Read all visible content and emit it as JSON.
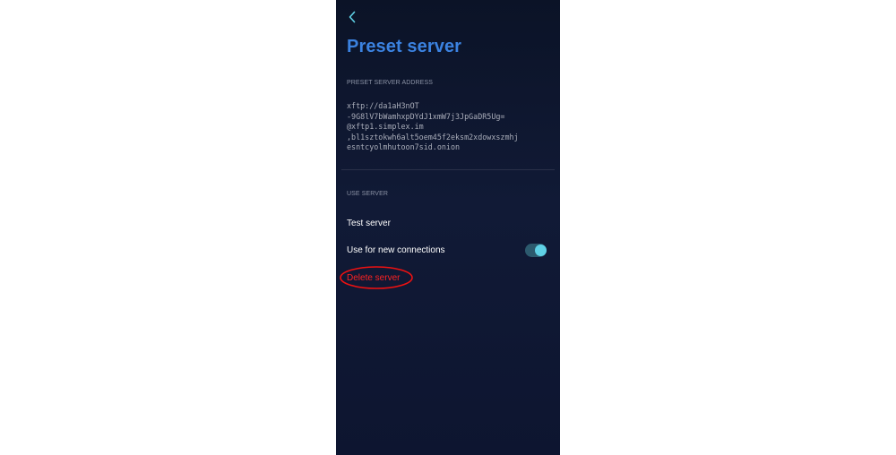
{
  "header": {
    "title": "Preset server",
    "back_icon": "chevron-left-icon"
  },
  "address_section": {
    "header": "PRESET SERVER ADDRESS",
    "lines": [
      "xftp://da1aH3nOT",
      "-9G8lV7bWamhxpDYdJ1xmW7j3JpGaDR5Ug=",
      "@xftp1.simplex.im",
      ",bl1sztokwh6alt5oem45f2eksm2xdowxszmhj",
      "esntcyolmhutoon7sid.onion"
    ]
  },
  "use_section": {
    "header": "USE SERVER",
    "test_label": "Test server",
    "new_connections_label": "Use for new connections",
    "new_connections_enabled": true,
    "delete_label": "Delete server"
  },
  "colors": {
    "background": "#0d1530",
    "title": "#3b82e0",
    "accent": "#5fd1e6",
    "toggle_track": "#2c5a6e",
    "section_header": "#8c93a6",
    "body_text": "#ffffff",
    "mono_text": "#a9adb9",
    "divider": "#2a3048",
    "danger": "#ff2222"
  }
}
